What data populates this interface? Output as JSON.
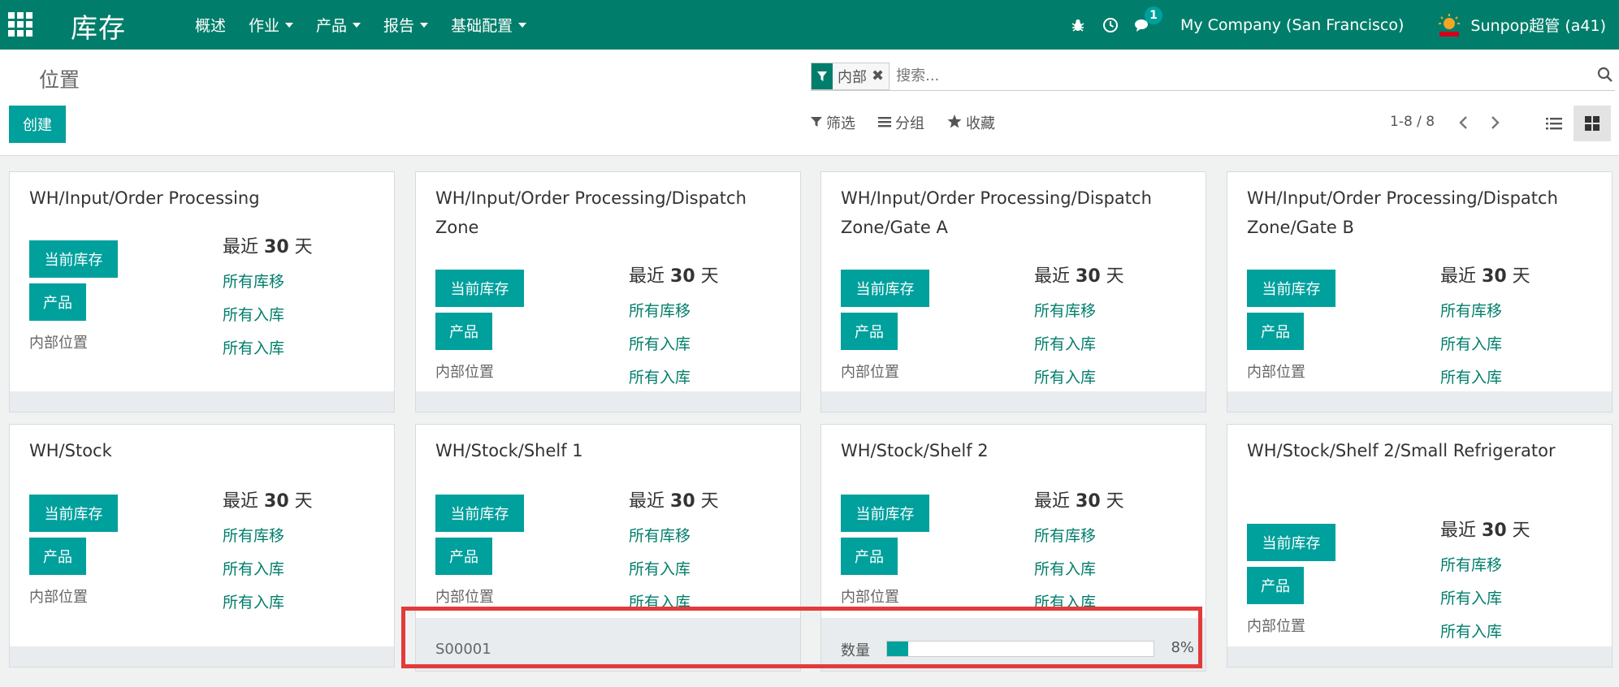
{
  "navbar": {
    "app_title": "库存",
    "menu": [
      {
        "label": "概述",
        "has_dropdown": false
      },
      {
        "label": "作业",
        "has_dropdown": true
      },
      {
        "label": "产品",
        "has_dropdown": true
      },
      {
        "label": "报告",
        "has_dropdown": true
      },
      {
        "label": "基础配置",
        "has_dropdown": true
      }
    ],
    "messages_count": "1",
    "company": "My Company (San Francisco)",
    "user": "Sunpop超管 (a41)"
  },
  "control_panel": {
    "breadcrumb": "位置",
    "create_label": "创建",
    "facet_label": "内部",
    "facet_close": "✖",
    "search_placeholder": "搜索...",
    "filter_label": "筛选",
    "group_label": "分组",
    "favorite_label": "收藏",
    "pager": "1-8 / 8"
  },
  "labels": {
    "current_stock": "当前库存",
    "product": "产品",
    "internal_location": "内部位置",
    "recent_prefix": "最近",
    "recent_days": "30",
    "recent_suffix": "天",
    "all_moves": "所有库移",
    "all_receipts_1": "所有入库",
    "all_receipts_2": "所有入库"
  },
  "cards": [
    {
      "title": "WH/Input/Order Processing"
    },
    {
      "title": "WH/Input/Order Processing/Dispatch Zone"
    },
    {
      "title": "WH/Input/Order Processing/Dispatch Zone/Gate A"
    },
    {
      "title": "WH/Input/Order Processing/Dispatch Zone/Gate B"
    },
    {
      "title": "WH/Stock"
    },
    {
      "title": "WH/Stock/Shelf 1",
      "footer_text": "S00001"
    },
    {
      "title": "WH/Stock/Shelf 2",
      "progress_label": "数量",
      "progress_value": "8%",
      "progress_fraction": 0.08
    },
    {
      "title": "WH/Stock/Shelf 2/Small Refrigerator"
    }
  ],
  "colors": {
    "brand": "#017e6b",
    "accent": "#00a09d",
    "highlight": "#e33a3a"
  }
}
